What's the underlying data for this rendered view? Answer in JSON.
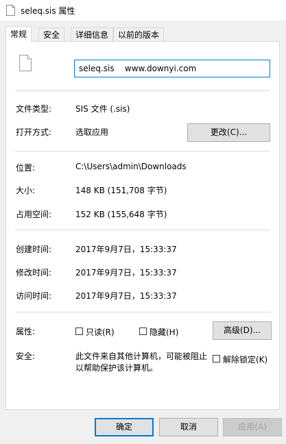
{
  "window": {
    "title": "seleq.sis 属性"
  },
  "tabs": [
    {
      "label": "常规",
      "active": true
    },
    {
      "label": "安全",
      "active": false
    },
    {
      "label": "详细信息",
      "active": false
    },
    {
      "label": "以前的版本",
      "active": false
    }
  ],
  "general": {
    "file_name": "seleq.sis    www.downyi.com",
    "file_type_label": "文件类型:",
    "file_type_value": "SIS 文件 (.sis)",
    "open_with_label": "打开方式:",
    "open_with_value": "选取应用",
    "change_button": "更改(C)...",
    "location_label": "位置:",
    "location_value": "C:\\Users\\admin\\Downloads",
    "size_label": "大小:",
    "size_value": "148 KB (151,708 字节)",
    "size_on_disk_label": "占用空间:",
    "size_on_disk_value": "152 KB (155,648 字节)",
    "created_label": "创建时间:",
    "created_value": "2017年9月7日，15:33:37",
    "modified_label": "修改时间:",
    "modified_value": "2017年9月7日，15:33:37",
    "accessed_label": "访问时间:",
    "accessed_value": "2017年9月7日，15:33:37",
    "attributes_label": "属性:",
    "readonly_label": "只读(R)",
    "readonly_checked": false,
    "hidden_label": "隐藏(H)",
    "hidden_checked": false,
    "advanced_button": "高级(D)...",
    "security_label": "安全:",
    "security_line1": "此文件来自其他计算机，可能被阻止",
    "security_line2": "以帮助保护该计算机。",
    "unblock_label": "解除锁定(K)",
    "unblock_checked": false
  },
  "footer": {
    "ok": "确定",
    "cancel": "取消",
    "apply": "应用(A)"
  }
}
